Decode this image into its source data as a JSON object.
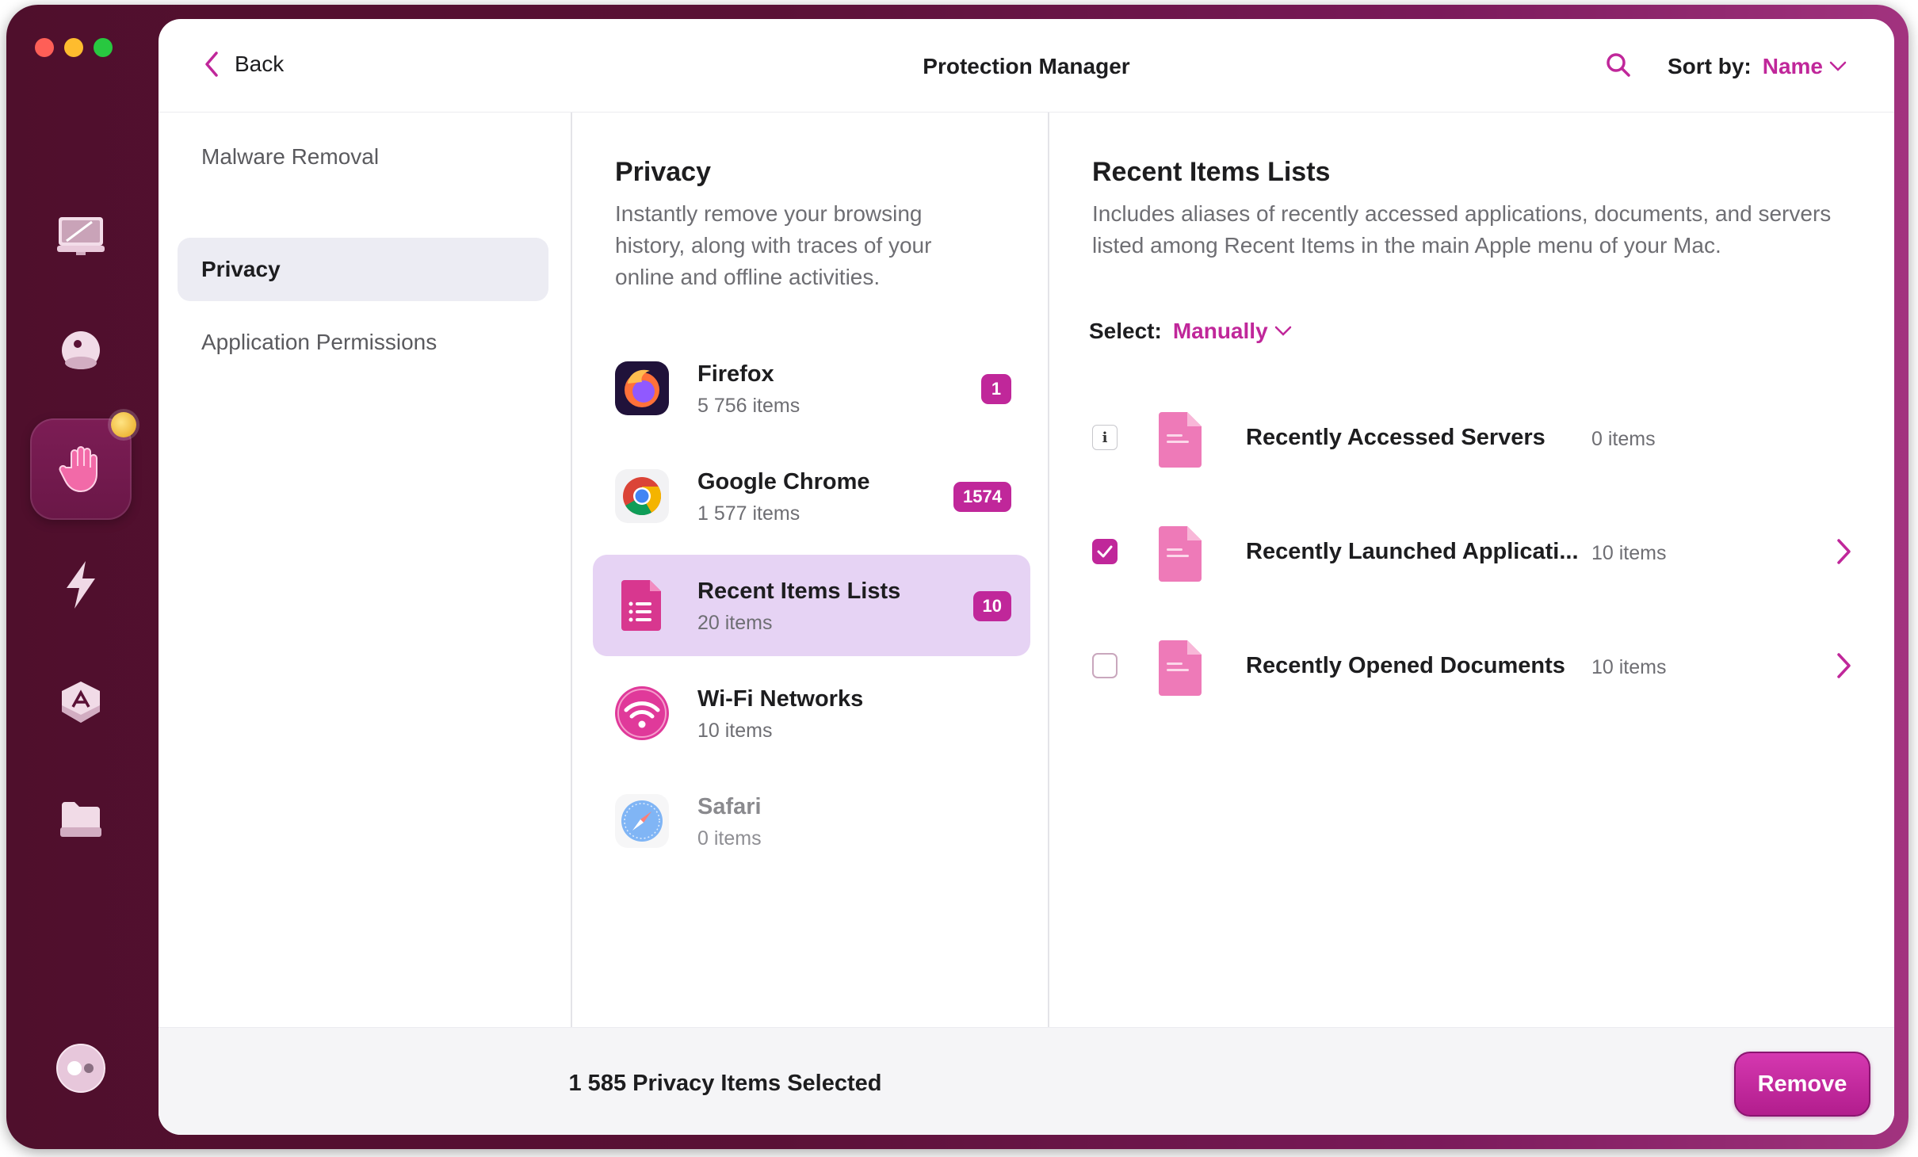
{
  "header": {
    "back_label": "Back",
    "title": "Protection Manager",
    "sort_label": "Sort by:",
    "sort_value": "Name"
  },
  "sidebar": {
    "items": [
      {
        "label": "Malware Removal",
        "active": false
      },
      {
        "label": "Privacy",
        "active": true
      },
      {
        "label": "Application Permissions",
        "active": false
      }
    ]
  },
  "privacy": {
    "title": "Privacy",
    "description": "Instantly remove your browsing history, along with traces of your online and offline activities.",
    "apps": [
      {
        "name": "Firefox",
        "count": "5 756 items",
        "badge": "1",
        "icon": "firefox-icon"
      },
      {
        "name": "Google Chrome",
        "count": "1 577 items",
        "badge": "1574",
        "icon": "chrome-icon"
      },
      {
        "name": "Recent Items Lists",
        "count": "20 items",
        "badge": "10",
        "icon": "recent-items-icon"
      },
      {
        "name": "Wi-Fi Networks",
        "count": "10 items",
        "badge": "",
        "icon": "wifi-icon"
      },
      {
        "name": "Safari",
        "count": "0 items",
        "badge": "",
        "icon": "safari-icon"
      }
    ]
  },
  "detail": {
    "title": "Recent Items Lists",
    "description": "Includes aliases of recently accessed applications, documents, and servers listed among Recent Items in the main Apple menu of your Mac.",
    "select_label": "Select:",
    "select_value": "Manually",
    "rows": [
      {
        "name": "Recently Accessed Servers",
        "count": "0 items",
        "control": "info"
      },
      {
        "name": "Recently Launched Applicati...",
        "count": "10 items",
        "control": "checked"
      },
      {
        "name": "Recently Opened Documents",
        "count": "10 items",
        "control": "unchecked"
      }
    ]
  },
  "footer": {
    "summary": "1 585 Privacy Items Selected",
    "remove_label": "Remove"
  },
  "colors": {
    "accent": "#c0279a",
    "selection": "#e6d3f4",
    "sidebar_bg": "#5a1136"
  }
}
